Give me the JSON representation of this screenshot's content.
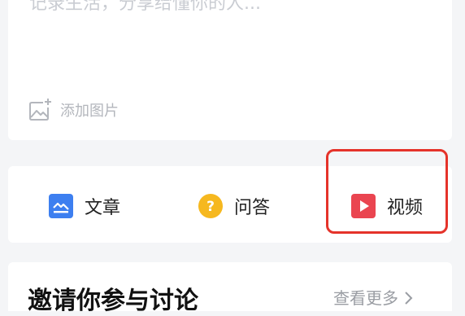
{
  "composer": {
    "placeholder": "记录生活，分享给懂你的人...",
    "add_image_label": "添加图片"
  },
  "post_types": [
    {
      "label": "文章",
      "icon": "article-icon",
      "color": "#3d7ff0"
    },
    {
      "label": "问答",
      "icon": "question-icon",
      "color": "#f6b81f"
    },
    {
      "label": "视频",
      "icon": "video-icon",
      "color": "#ea4550"
    }
  ],
  "highlight_color": "#e5332a",
  "discussion": {
    "title": "邀请你参与讨论",
    "more_label": "查看更多",
    "more_icon": "chevron-right-icon"
  }
}
